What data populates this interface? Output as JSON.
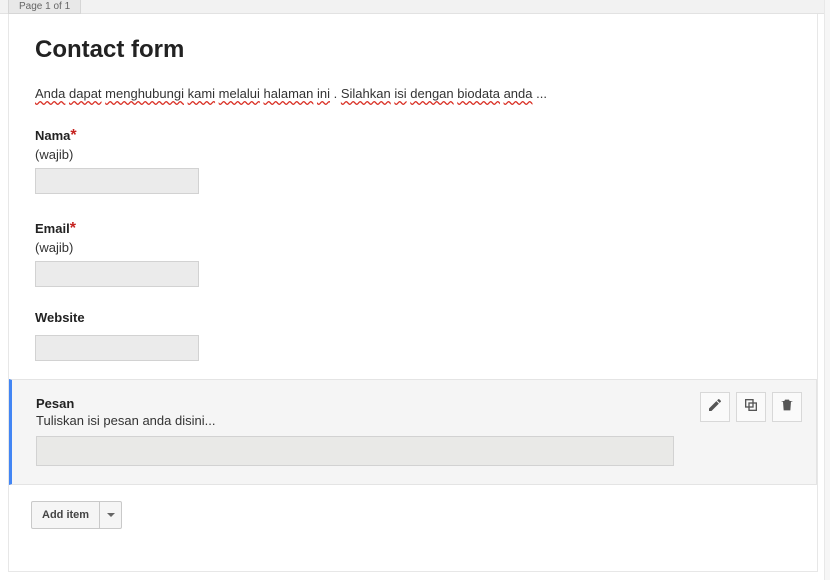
{
  "page_tab": "Page 1 of 1",
  "title": "Contact form",
  "description_words": [
    "Anda",
    "dapat",
    "menghubungi",
    "kami",
    "melalui",
    "halaman",
    "ini",
    ".",
    "Silahkan",
    "isi",
    "dengan",
    "biodata",
    "anda",
    "..."
  ],
  "description_spellflag": [
    true,
    true,
    true,
    true,
    true,
    true,
    true,
    false,
    true,
    true,
    true,
    true,
    true,
    false
  ],
  "fields": {
    "nama": {
      "label": "Nama",
      "required": true,
      "hint": "(wajib)"
    },
    "email": {
      "label": "Email",
      "required": true,
      "hint": "(wajib)"
    },
    "website": {
      "label": "Website",
      "required": false,
      "hint": ""
    }
  },
  "selected_field": {
    "label": "Pesan",
    "sub": "Tuliskan isi pesan anda disini..."
  },
  "toolbar": {
    "add_item": "Add item"
  }
}
